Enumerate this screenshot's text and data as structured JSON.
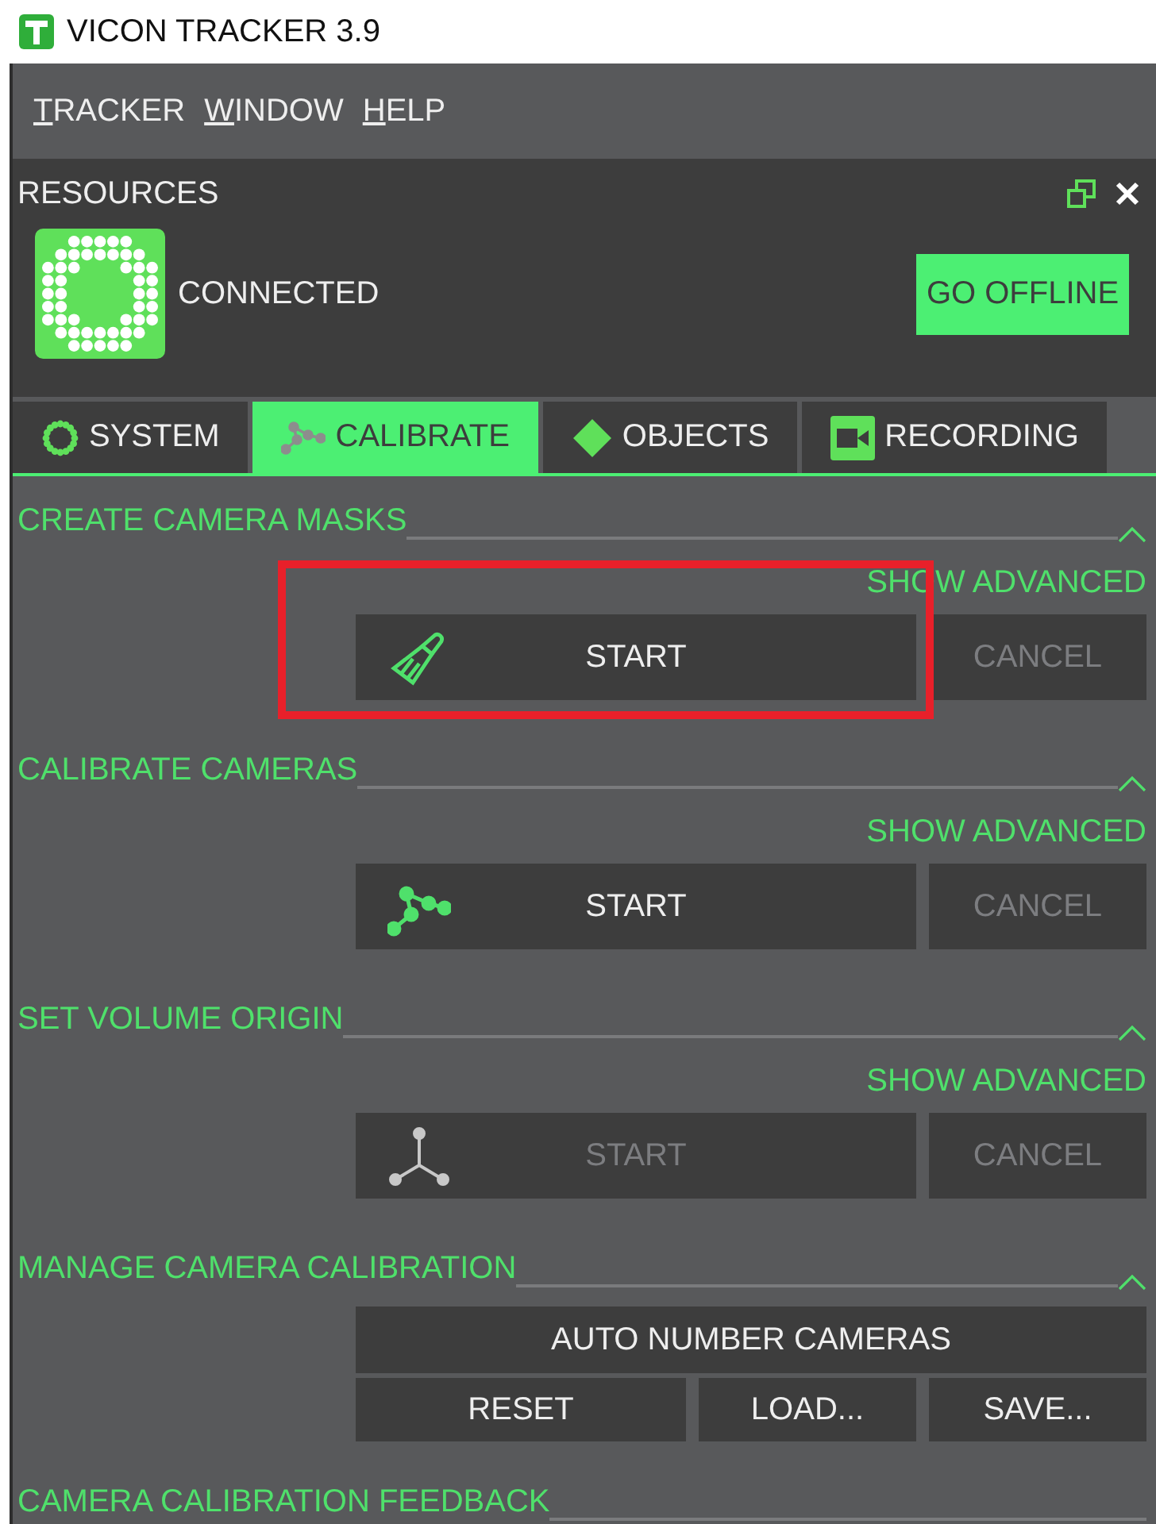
{
  "window": {
    "title": "VICON TRACKER 3.9"
  },
  "menu": [
    {
      "label": "TRACKER",
      "underline_first": true
    },
    {
      "label": "WINDOW",
      "underline_first": true
    },
    {
      "label": "HELP",
      "underline_first": true
    }
  ],
  "resources": {
    "title": "RESOURCES",
    "status": "CONNECTED",
    "connected": true,
    "action": "GO OFFLINE"
  },
  "tabs": [
    {
      "label": "SYSTEM",
      "selected": false
    },
    {
      "label": "CALIBRATE",
      "selected": true
    },
    {
      "label": "OBJECTS",
      "selected": false
    },
    {
      "label": "RECORDING",
      "selected": false
    }
  ],
  "sections": [
    {
      "kind": "task",
      "title": "CREATE CAMERA MASKS",
      "expanded": true,
      "advanced": "SHOW ADVANCED",
      "start": {
        "label": "START",
        "disabled": false,
        "highlighted": true
      },
      "cancel": {
        "label": "CANCEL",
        "disabled": true
      }
    },
    {
      "kind": "task",
      "title": "CALIBRATE CAMERAS",
      "expanded": true,
      "advanced": "SHOW ADVANCED",
      "start": {
        "label": "START",
        "disabled": false,
        "highlighted": false
      },
      "cancel": {
        "label": "CANCEL",
        "disabled": true
      }
    },
    {
      "kind": "task",
      "title": "SET VOLUME ORIGIN",
      "expanded": true,
      "advanced": "SHOW ADVANCED",
      "start": {
        "label": "START",
        "disabled": true,
        "highlighted": false
      },
      "cancel": {
        "label": "CANCEL",
        "disabled": true
      }
    },
    {
      "kind": "manage",
      "title": "MANAGE CAMERA CALIBRATION",
      "expanded": true,
      "buttons": [
        "AUTO NUMBER CAMERAS",
        "RESET",
        "LOAD...",
        "SAVE..."
      ]
    },
    {
      "kind": "header",
      "title": "CAMERA CALIBRATION FEEDBACK"
    }
  ]
}
